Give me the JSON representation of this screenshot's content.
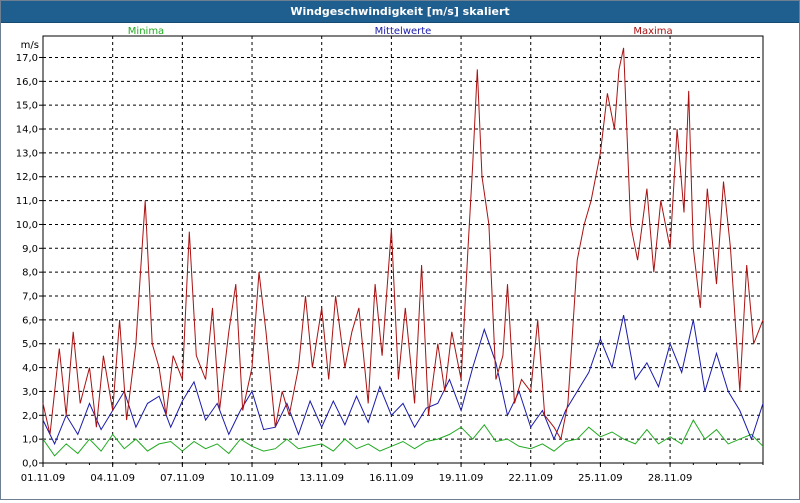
{
  "window": {
    "title": "Windgeschwindigkeit [m/s] skaliert"
  },
  "chart_data": {
    "type": "line",
    "title": "Windgeschwindigkeit [m/s] skaliert",
    "ylabel": "m/s",
    "xlabel": "",
    "ylim": [
      0,
      17.9
    ],
    "xlim_days": [
      0,
      31
    ],
    "y_ticks": [
      "0,0",
      "1,0",
      "2,0",
      "3,0",
      "4,0",
      "5,0",
      "6,0",
      "7,0",
      "8,0",
      "9,0",
      "10,0",
      "11,0",
      "12,0",
      "13,0",
      "14,0",
      "15,0",
      "16,0",
      "17,0"
    ],
    "x_ticks": [
      "01.11.09",
      "04.11.09",
      "07.11.09",
      "10.11.09",
      "13.11.09",
      "16.11.09",
      "19.11.09",
      "22.11.09",
      "25.11.09",
      "28.11.09"
    ],
    "grid": true,
    "legend_position": "top",
    "series": [
      {
        "name": "Minima",
        "color": "#22aa22",
        "points": [
          [
            0.0,
            1.0
          ],
          [
            0.5,
            0.3
          ],
          [
            1.0,
            0.8
          ],
          [
            1.5,
            0.4
          ],
          [
            2.0,
            1.0
          ],
          [
            2.5,
            0.5
          ],
          [
            3.0,
            1.2
          ],
          [
            3.5,
            0.6
          ],
          [
            4.0,
            1.0
          ],
          [
            4.5,
            0.5
          ],
          [
            5.0,
            0.8
          ],
          [
            5.5,
            0.9
          ],
          [
            6.0,
            0.5
          ],
          [
            6.5,
            0.9
          ],
          [
            7.0,
            0.6
          ],
          [
            7.5,
            0.8
          ],
          [
            8.0,
            0.4
          ],
          [
            8.5,
            1.0
          ],
          [
            9.0,
            0.7
          ],
          [
            9.5,
            0.5
          ],
          [
            10.0,
            0.6
          ],
          [
            10.5,
            1.0
          ],
          [
            11.0,
            0.6
          ],
          [
            11.5,
            0.7
          ],
          [
            12.0,
            0.8
          ],
          [
            12.5,
            0.5
          ],
          [
            13.0,
            1.0
          ],
          [
            13.5,
            0.6
          ],
          [
            14.0,
            0.8
          ],
          [
            14.5,
            0.5
          ],
          [
            15.0,
            0.7
          ],
          [
            15.5,
            0.9
          ],
          [
            16.0,
            0.6
          ],
          [
            16.5,
            0.9
          ],
          [
            17.0,
            1.0
          ],
          [
            17.5,
            1.2
          ],
          [
            18.0,
            1.5
          ],
          [
            18.5,
            1.0
          ],
          [
            19.0,
            1.6
          ],
          [
            19.5,
            0.9
          ],
          [
            20.0,
            1.0
          ],
          [
            20.5,
            0.7
          ],
          [
            21.0,
            0.6
          ],
          [
            21.5,
            0.8
          ],
          [
            22.0,
            0.5
          ],
          [
            22.5,
            0.9
          ],
          [
            23.0,
            1.0
          ],
          [
            23.5,
            1.5
          ],
          [
            24.0,
            1.1
          ],
          [
            24.5,
            1.3
          ],
          [
            25.0,
            1.0
          ],
          [
            25.5,
            0.8
          ],
          [
            26.0,
            1.4
          ],
          [
            26.5,
            0.8
          ],
          [
            27.0,
            1.1
          ],
          [
            27.5,
            0.8
          ],
          [
            28.0,
            1.8
          ],
          [
            28.5,
            1.0
          ],
          [
            29.0,
            1.4
          ],
          [
            29.5,
            0.8
          ],
          [
            30.0,
            1.0
          ],
          [
            30.5,
            1.2
          ],
          [
            31.0,
            0.7
          ]
        ]
      },
      {
        "name": "Mittelwerte",
        "color": "#1a1aaa",
        "points": [
          [
            0.0,
            1.8
          ],
          [
            0.5,
            0.8
          ],
          [
            1.0,
            2.0
          ],
          [
            1.5,
            1.2
          ],
          [
            2.0,
            2.5
          ],
          [
            2.5,
            1.4
          ],
          [
            3.0,
            2.2
          ],
          [
            3.5,
            3.0
          ],
          [
            4.0,
            1.5
          ],
          [
            4.5,
            2.5
          ],
          [
            5.0,
            2.8
          ],
          [
            5.5,
            1.5
          ],
          [
            6.0,
            2.6
          ],
          [
            6.5,
            3.4
          ],
          [
            7.0,
            1.8
          ],
          [
            7.5,
            2.5
          ],
          [
            8.0,
            1.2
          ],
          [
            8.5,
            2.2
          ],
          [
            9.0,
            3.0
          ],
          [
            9.5,
            1.4
          ],
          [
            10.0,
            1.5
          ],
          [
            10.5,
            2.5
          ],
          [
            11.0,
            1.2
          ],
          [
            11.5,
            2.6
          ],
          [
            12.0,
            1.5
          ],
          [
            12.5,
            2.6
          ],
          [
            13.0,
            1.6
          ],
          [
            13.5,
            2.8
          ],
          [
            14.0,
            1.7
          ],
          [
            14.5,
            3.2
          ],
          [
            15.0,
            2.0
          ],
          [
            15.5,
            2.5
          ],
          [
            16.0,
            1.5
          ],
          [
            16.5,
            2.3
          ],
          [
            17.0,
            2.5
          ],
          [
            17.5,
            3.5
          ],
          [
            18.0,
            2.2
          ],
          [
            18.5,
            4.0
          ],
          [
            19.0,
            5.6
          ],
          [
            19.5,
            4.2
          ],
          [
            20.0,
            2.0
          ],
          [
            20.5,
            3.0
          ],
          [
            21.0,
            1.5
          ],
          [
            21.5,
            2.2
          ],
          [
            22.0,
            1.0
          ],
          [
            22.5,
            2.2
          ],
          [
            23.0,
            3.0
          ],
          [
            23.5,
            3.8
          ],
          [
            24.0,
            5.2
          ],
          [
            24.5,
            4.0
          ],
          [
            25.0,
            6.2
          ],
          [
            25.5,
            3.5
          ],
          [
            26.0,
            4.2
          ],
          [
            26.5,
            3.2
          ],
          [
            27.0,
            5.0
          ],
          [
            27.5,
            3.8
          ],
          [
            28.0,
            6.0
          ],
          [
            28.5,
            3.0
          ],
          [
            29.0,
            4.6
          ],
          [
            29.5,
            3.0
          ],
          [
            30.0,
            2.2
          ],
          [
            30.5,
            1.0
          ],
          [
            31.0,
            2.5
          ]
        ]
      },
      {
        "name": "Maxima",
        "color": "#aa1111",
        "points": [
          [
            0.0,
            2.5
          ],
          [
            0.3,
            1.2
          ],
          [
            0.7,
            4.8
          ],
          [
            1.0,
            2.0
          ],
          [
            1.3,
            5.5
          ],
          [
            1.6,
            2.5
          ],
          [
            2.0,
            4.0
          ],
          [
            2.3,
            1.5
          ],
          [
            2.6,
            4.5
          ],
          [
            3.0,
            2.2
          ],
          [
            3.3,
            6.0
          ],
          [
            3.6,
            1.8
          ],
          [
            4.0,
            5.0
          ],
          [
            4.2,
            8.0
          ],
          [
            4.4,
            11.0
          ],
          [
            4.7,
            5.0
          ],
          [
            5.0,
            4.0
          ],
          [
            5.3,
            2.0
          ],
          [
            5.6,
            4.5
          ],
          [
            6.0,
            3.5
          ],
          [
            6.3,
            9.7
          ],
          [
            6.6,
            4.5
          ],
          [
            7.0,
            3.5
          ],
          [
            7.3,
            6.5
          ],
          [
            7.6,
            2.2
          ],
          [
            8.0,
            5.5
          ],
          [
            8.3,
            7.5
          ],
          [
            8.6,
            2.2
          ],
          [
            9.0,
            4.0
          ],
          [
            9.3,
            8.0
          ],
          [
            9.6,
            5.5
          ],
          [
            10.0,
            1.5
          ],
          [
            10.3,
            3.0
          ],
          [
            10.6,
            2.0
          ],
          [
            11.0,
            4.0
          ],
          [
            11.3,
            7.0
          ],
          [
            11.6,
            4.0
          ],
          [
            12.0,
            6.5
          ],
          [
            12.3,
            3.5
          ],
          [
            12.6,
            7.0
          ],
          [
            13.0,
            4.0
          ],
          [
            13.3,
            5.5
          ],
          [
            13.6,
            6.5
          ],
          [
            14.0,
            2.5
          ],
          [
            14.3,
            7.5
          ],
          [
            14.6,
            4.5
          ],
          [
            15.0,
            9.8
          ],
          [
            15.3,
            3.5
          ],
          [
            15.6,
            6.5
          ],
          [
            16.0,
            2.5
          ],
          [
            16.3,
            8.3
          ],
          [
            16.6,
            2.0
          ],
          [
            17.0,
            5.0
          ],
          [
            17.3,
            3.0
          ],
          [
            17.6,
            5.5
          ],
          [
            18.0,
            3.5
          ],
          [
            18.3,
            9.0
          ],
          [
            18.5,
            12.5
          ],
          [
            18.7,
            16.5
          ],
          [
            18.9,
            12.0
          ],
          [
            19.2,
            10.0
          ],
          [
            19.5,
            3.5
          ],
          [
            19.8,
            4.5
          ],
          [
            20.0,
            7.5
          ],
          [
            20.3,
            2.5
          ],
          [
            20.6,
            3.5
          ],
          [
            21.0,
            3.0
          ],
          [
            21.3,
            6.0
          ],
          [
            21.6,
            2.0
          ],
          [
            22.0,
            1.5
          ],
          [
            22.3,
            1.0
          ],
          [
            22.6,
            2.5
          ],
          [
            23.0,
            8.5
          ],
          [
            23.3,
            10.0
          ],
          [
            23.6,
            11.0
          ],
          [
            24.0,
            13.0
          ],
          [
            24.3,
            15.5
          ],
          [
            24.6,
            14.0
          ],
          [
            24.8,
            16.5
          ],
          [
            25.0,
            17.4
          ],
          [
            25.3,
            10.0
          ],
          [
            25.6,
            8.5
          ],
          [
            26.0,
            11.5
          ],
          [
            26.3,
            8.0
          ],
          [
            26.6,
            11.0
          ],
          [
            27.0,
            9.0
          ],
          [
            27.3,
            14.0
          ],
          [
            27.6,
            10.5
          ],
          [
            27.8,
            15.6
          ],
          [
            28.0,
            9.0
          ],
          [
            28.3,
            6.5
          ],
          [
            28.6,
            11.5
          ],
          [
            29.0,
            7.5
          ],
          [
            29.3,
            11.8
          ],
          [
            29.6,
            9.0
          ],
          [
            30.0,
            3.0
          ],
          [
            30.3,
            8.3
          ],
          [
            30.6,
            5.0
          ],
          [
            31.0,
            6.0
          ]
        ]
      }
    ]
  }
}
